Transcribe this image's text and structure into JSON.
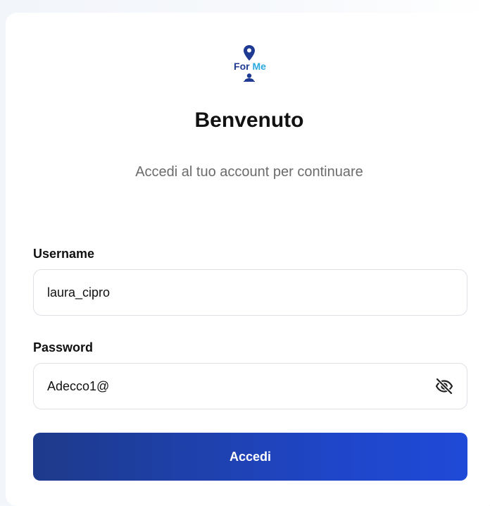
{
  "brand": {
    "logo_for": "For",
    "logo_me": "Me",
    "color_primary": "#1f3a93",
    "color_accent": "#2ba8e0"
  },
  "header": {
    "title": "Benvenuto",
    "subtitle": "Accedi al tuo account per continuare"
  },
  "form": {
    "username_label": "Username",
    "username_value": "laura_cipro",
    "password_label": "Password",
    "password_value": "Adecco1@",
    "password_toggle_icon": "eye-off-icon",
    "submit_label": "Accedi",
    "submit_color_start": "#1e3a8a",
    "submit_color_end": "#1f4ad8"
  }
}
